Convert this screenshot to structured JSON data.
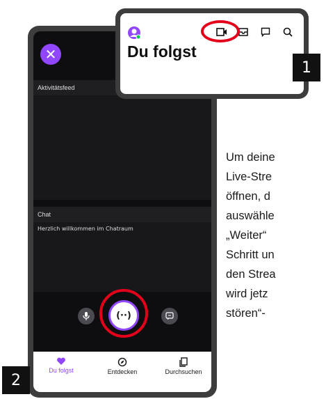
{
  "inset": {
    "title": "Du folgst"
  },
  "phone": {
    "activity_header": "Aktivitätsfeed",
    "chat_header": "Chat",
    "welcome_message": "Herzlich willkommen im Chatraum",
    "live_button_label": "(··)"
  },
  "navbar": {
    "items": [
      {
        "label": "Du folgst",
        "icon": "heart-icon"
      },
      {
        "label": "Entdecken",
        "icon": "compass-icon"
      },
      {
        "label": "Durchsuchen",
        "icon": "browse-icon"
      }
    ]
  },
  "badges": {
    "step1": "1",
    "step2": "2"
  },
  "instructions": {
    "lines": [
      "Um deine",
      "Live-Stre",
      "öffnen, d",
      "auswähle",
      "„Weiter“",
      "Schritt un",
      "den Strea",
      "wird jetz",
      "stören“-"
    ]
  },
  "colors": {
    "accent": "#9147ff",
    "highlight_ring": "#e3001b",
    "phone_frame": "#3d3d3d",
    "screen_bg": "#0e0e10"
  }
}
